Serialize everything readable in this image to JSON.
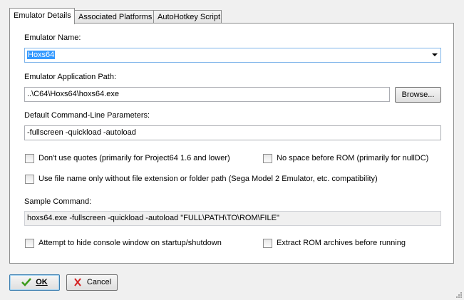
{
  "tabs": [
    {
      "label": "Emulator Details",
      "active": true
    },
    {
      "label": "Associated Platforms",
      "active": false
    },
    {
      "label": "AutoHotkey Script",
      "active": false
    }
  ],
  "emulator_name": {
    "label": "Emulator Name:",
    "value": "Hoxs64"
  },
  "app_path": {
    "label": "Emulator Application Path:",
    "value": "..\\C64\\Hoxs64\\hoxs64.exe",
    "browse_label": "Browse..."
  },
  "cmdline": {
    "label": "Default Command-Line Parameters:",
    "value": "-fullscreen -quickload -autoload"
  },
  "options": {
    "dont_use_quotes": {
      "label": "Don't use quotes (primarily for Project64 1.6 and lower)",
      "checked": false
    },
    "no_space_before_rom": {
      "label": "No space before ROM (primarily for nullDC)",
      "checked": false
    },
    "file_name_only": {
      "label": "Use file name only without file extension or folder path (Sega Model 2 Emulator, etc. compatibility)",
      "checked": false
    },
    "hide_console": {
      "label": "Attempt to hide console window on startup/shutdown",
      "checked": false
    },
    "extract_rom": {
      "label": "Extract ROM archives before running",
      "checked": false
    }
  },
  "sample_command": {
    "label": "Sample Command:",
    "value": "hoxs64.exe -fullscreen -quickload -autoload \"FULL\\PATH\\TO\\ROM\\FILE\""
  },
  "buttons": {
    "ok": "OK",
    "cancel": "Cancel"
  },
  "colors": {
    "selection": "#3399ff",
    "ok_check": "#3a9a1a",
    "cancel_x": "#d42020"
  }
}
